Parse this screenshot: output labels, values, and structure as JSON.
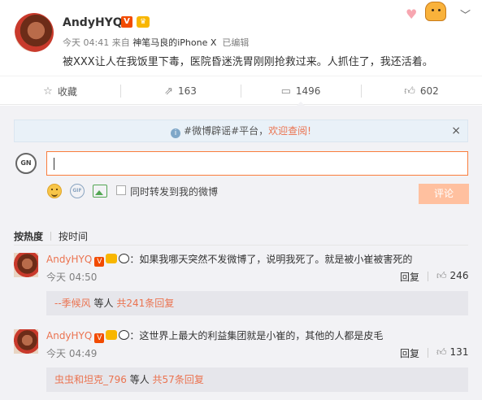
{
  "post": {
    "username": "AndyHYQ",
    "verified_badge": "V",
    "time": "今天 04:41",
    "from_label": "来自",
    "device": "神笔马良的iPhone X",
    "edited": "已编辑",
    "content": "被XXX让人在我饭里下毒，医院昏迷洗胃刚刚抢救过来。人抓住了，我还活着。"
  },
  "actions": {
    "favorite": {
      "icon": "star-icon",
      "label": "收藏"
    },
    "repost": {
      "icon": "repost-icon",
      "label": "163"
    },
    "comment": {
      "icon": "comment-icon",
      "label": "1496"
    },
    "like": {
      "icon": "thumbs-up-icon",
      "label": "602"
    }
  },
  "notice": {
    "info_icon": "i",
    "hashtag": "#微博辟谣#平台",
    "separator": "，",
    "link": "欢迎查阅!",
    "close": "×"
  },
  "composer": {
    "avatar_text": "GN",
    "gif_text": "GIF",
    "repost_checkbox_label": "同时转发到我的微博",
    "submit_label": "评论"
  },
  "sort": {
    "hot": "按热度",
    "time": "按时间"
  },
  "comments": [
    {
      "username": "AndyHYQ",
      "badge": "V",
      "text": "：如果我哪天突然不发微博了，说明我死了。就是被小崔被害死的",
      "time": "今天 04:50",
      "reply_label": "回复",
      "likes": "246",
      "sub_user": "--季候风",
      "sub_mid": " 等人 ",
      "sub_count": "共241条回复"
    },
    {
      "username": "AndyHYQ",
      "badge": "V",
      "text": "：这世界上最大的利益集团就是小崔的，其他的人都是皮毛",
      "time": "今天 04:49",
      "reply_label": "回复",
      "likes": "131",
      "sub_user": "虫虫和坦克_796",
      "sub_mid": " 等人 ",
      "sub_count": "共57条回复"
    }
  ],
  "colors": {
    "accent": "#eb7350",
    "input_border": "#fa7d3c",
    "submit_disabled": "#ffc09f",
    "verified": "#f24b00",
    "background": "#f2f2f5"
  }
}
